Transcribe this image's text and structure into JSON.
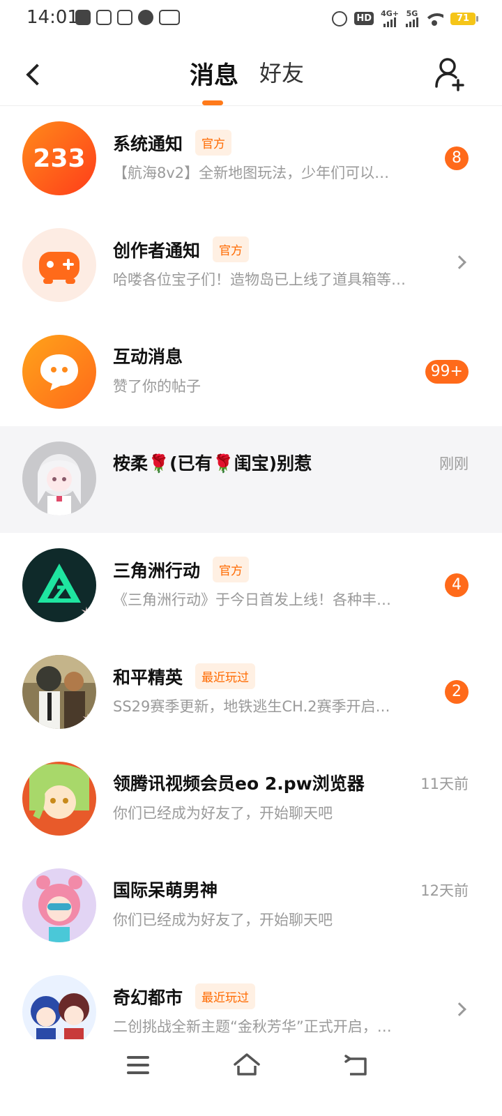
{
  "status_bar": {
    "time": "14:01",
    "battery": "71",
    "net1": "4G+",
    "net2": "5G",
    "hd": "HD"
  },
  "header": {
    "tab_messages": "消息",
    "tab_friends": "好友"
  },
  "accent_color": "#ff6a1a",
  "conversations": [
    {
      "name": "系统通知",
      "tag": "官方",
      "preview": "【航海8v2】全新地图玩法，少年们可以…",
      "badge": "8",
      "time": "",
      "avatar": "orange-233-logo"
    },
    {
      "name": "创作者通知",
      "tag": "官方",
      "preview": "哈喽各位宝子们！造物岛已上线了道具箱等…",
      "badge": "",
      "time": "",
      "avatar": "gamepad-logo"
    },
    {
      "name": "互动消息",
      "tag": "",
      "preview": "赞了你的帖子",
      "badge": "99+",
      "time": "",
      "avatar": "chat-bubble-logo"
    },
    {
      "name": "桉柔🌹(已有🌹闺宝)别惹",
      "tag": "",
      "preview": "",
      "badge": "",
      "time": "刚刚",
      "avatar": "user-photo"
    },
    {
      "name": "三角洲行动",
      "tag": "官方",
      "preview": "《三角洲行动》于今日首发上线！各种丰…",
      "badge": "4",
      "time": "",
      "avatar": "delta-force-logo"
    },
    {
      "name": "和平精英",
      "tag": "最近玩过",
      "preview": "SS29赛季更新，地铁逃生CH.2赛季开启…",
      "badge": "2",
      "time": "",
      "avatar": "game-art"
    },
    {
      "name": "领腾讯视频会员eo 2.pw浏览器",
      "tag": "",
      "preview": "你们已经成为好友了，开始聊天吧",
      "badge": "",
      "time": "11天前",
      "avatar": "user-photo"
    },
    {
      "name": "国际呆萌男神",
      "tag": "",
      "preview": "你们已经成为好友了，开始聊天吧",
      "badge": "",
      "time": "12天前",
      "avatar": "user-photo"
    },
    {
      "name": "奇幻都市",
      "tag": "最近玩过",
      "preview": "二创挑战全新主题“金秋芳华”正式开启，…",
      "badge": "",
      "time": "",
      "avatar": "game-art"
    }
  ]
}
